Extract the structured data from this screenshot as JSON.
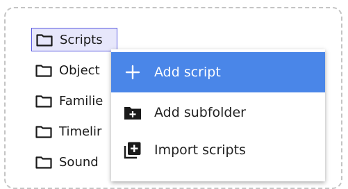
{
  "tree": {
    "items": [
      {
        "label": "Scripts",
        "icon": "folder-icon",
        "selected": true
      },
      {
        "label": "Object",
        "icon": "folder-icon"
      },
      {
        "label": "Familie",
        "icon": "folder-icon"
      },
      {
        "label": "Timelir",
        "icon": "folder-icon"
      },
      {
        "label": "Sound",
        "icon": "folder-icon"
      }
    ]
  },
  "context_menu": {
    "items": [
      {
        "label": "Add script",
        "icon": "plus-icon",
        "highlighted": true
      },
      {
        "label": "Add subfolder",
        "icon": "add-folder-icon"
      },
      {
        "label": "Import scripts",
        "icon": "import-icon"
      }
    ]
  },
  "colors": {
    "highlight": "#4a86e8",
    "selection_border": "#5a5ae0",
    "selection_fill": "#e7e7fb"
  }
}
